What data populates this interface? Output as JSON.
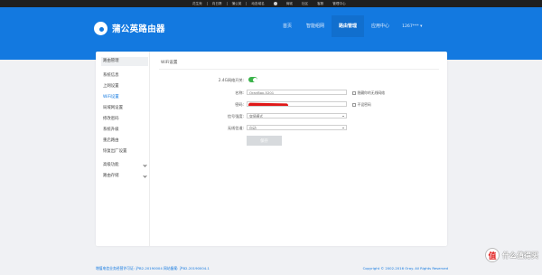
{
  "topbar": {
    "links": [
      "花生壳",
      "向日葵",
      "蒲公英",
      "动态域名",
      "商城",
      "社区",
      "客服",
      "管理中心"
    ]
  },
  "header": {
    "logo_text": "蒲公英路由器",
    "nav": [
      "首页",
      "智能组网",
      "路由管理",
      "应用中心"
    ],
    "active_nav": "路由管理",
    "user": "1267*** ▾"
  },
  "sidebar": {
    "title": "路由管理",
    "items": [
      "系统信息",
      "上网设置",
      "WiFi设置",
      "局域网设置",
      "修改密码",
      "系统升级",
      "重启路由",
      "恢复出厂设置"
    ],
    "active_item": "WiFi设置",
    "groups": [
      "高级功能",
      "路由存储"
    ]
  },
  "wifi": {
    "title": "WiFi设置",
    "labels": {
      "switch": "2.4G网络开关:",
      "name": "名称:",
      "password": "密码:",
      "security": "信号强度:",
      "channel": "无线信道:"
    },
    "name_value": "OrayBox-5201",
    "security_value": "穿墙模式",
    "channel_value": "自动",
    "hide_ssid_label": "隐藏你的无线网络",
    "no_password_label": "不设密码",
    "save_label": "保存"
  },
  "footer": {
    "left": "增值电信业务经营许可证: 沪B2-20190004   网站备案: 沪B2-20190004-1",
    "right": "Copyright © 2002-2016 Oray. All Rights Reserved"
  },
  "watermark": {
    "badge": "值",
    "text": "什么值得买"
  },
  "colors": {
    "brand_blue": "#1379e0",
    "toggle_on": "#3bb34a",
    "redaction": "#e01818"
  }
}
